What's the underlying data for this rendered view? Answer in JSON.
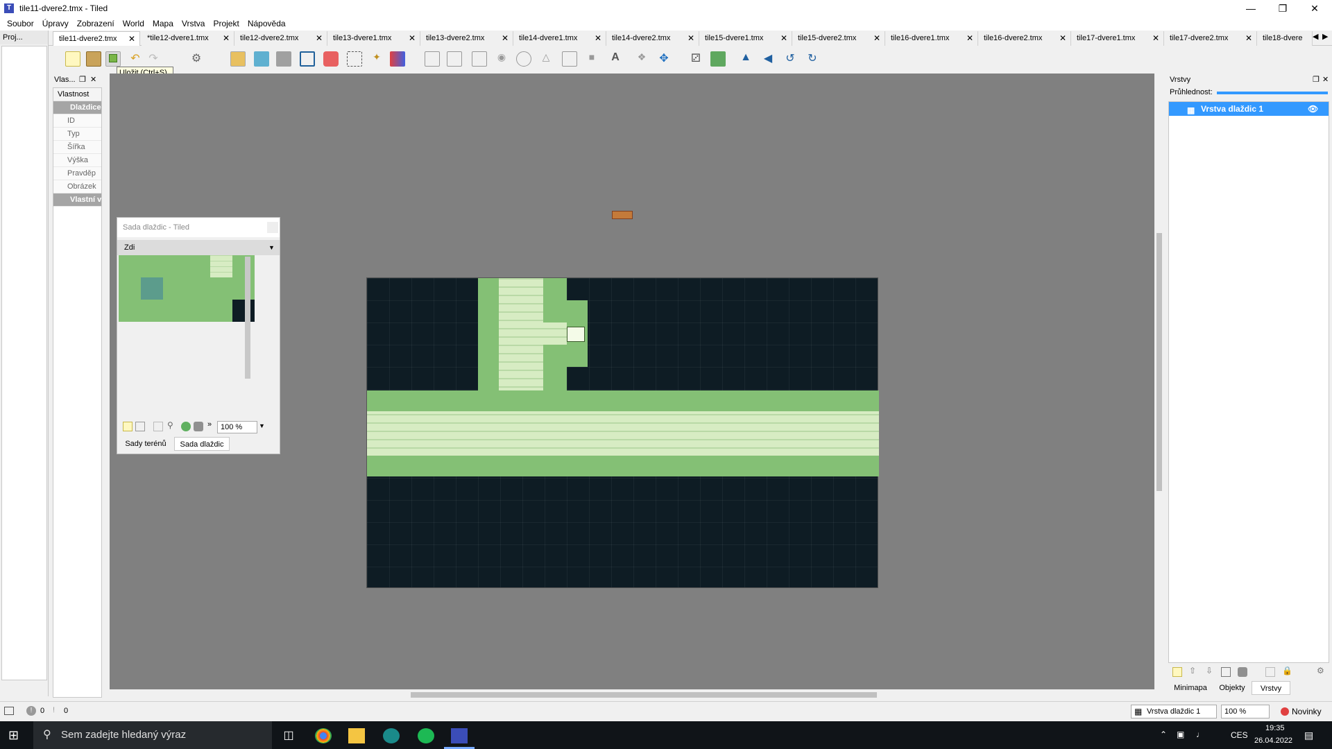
{
  "window": {
    "title": "tile11-dvere2.tmx - Tiled",
    "app_icon": "T"
  },
  "menu": [
    {
      "label": "Soubor"
    },
    {
      "label": "Úpravy"
    },
    {
      "label": "Zobrazení"
    },
    {
      "label": "World"
    },
    {
      "label": "Mapa"
    },
    {
      "label": "Vrstva"
    },
    {
      "label": "Projekt"
    },
    {
      "label": "Nápověda"
    }
  ],
  "tabs": [
    {
      "label": "tile11-dvere2.tmx"
    },
    {
      "label": "*tile12-dvere1.tmx"
    },
    {
      "label": "tile12-dvere2.tmx"
    },
    {
      "label": "tile13-dvere1.tmx"
    },
    {
      "label": "tile13-dvere2.tmx"
    },
    {
      "label": "tile14-dvere1.tmx"
    },
    {
      "label": "tile14-dvere2.tmx"
    },
    {
      "label": "tile15-dvere1.tmx"
    },
    {
      "label": "tile15-dvere2.tmx"
    },
    {
      "label": "tile16-dvere1.tmx"
    },
    {
      "label": "tile16-dvere2.tmx"
    },
    {
      "label": "tile17-dvere1.tmx"
    },
    {
      "label": "tile17-dvere2.tmx"
    },
    {
      "label": "tile18-dvere"
    }
  ],
  "project_dock": {
    "title": "Proj..."
  },
  "tooltip": "Uložit (Ctrl+S)",
  "properties": {
    "title": "Vlas...",
    "header": "Vlastnost",
    "group_tile": "Dlaždice",
    "rows": [
      "ID",
      "Typ",
      "Šířka",
      "Výška",
      "Pravděp",
      "Obrázek"
    ],
    "group_custom": "Vlastní v"
  },
  "tileset": {
    "window_title": "Sada dlaždic - Tiled",
    "selected": "Zdi",
    "zoom": "100 %",
    "tabs": [
      "Sady terénů",
      "Sada dlaždic"
    ]
  },
  "layers": {
    "title": "Vrstvy",
    "opacity_label": "Průhlednost:",
    "layer_name": "Vrstva dlaždic 1",
    "bottom_tabs": [
      "Minimapa",
      "Objekty",
      "Vrstvy"
    ]
  },
  "statusbar": {
    "errors": "0",
    "warnings": "0",
    "layer": "Vrstva dlaždic 1",
    "zoom": "100 %",
    "news": "Novinky"
  },
  "taskbar": {
    "search_placeholder": "Sem zadejte hledaný výraz",
    "lang": "CES",
    "time": "19:35",
    "date": "26.04.2022"
  },
  "colors": {
    "floor_dark": "#0e1c24",
    "wall_green": "#84c075",
    "brick_light": "#d7ecc3",
    "accent": "#3399ff"
  }
}
